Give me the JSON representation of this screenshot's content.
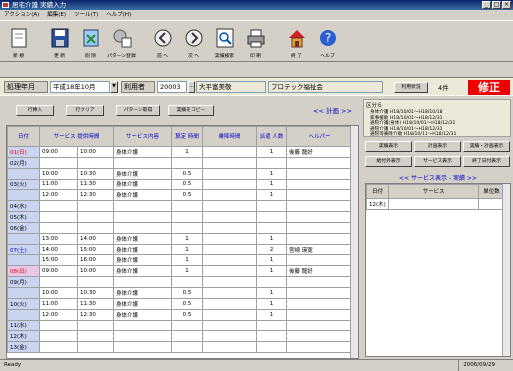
{
  "window": {
    "title": "居宅介護 実績入力"
  },
  "menu": [
    "アクション(A)",
    "編集(E)",
    "ツール(T)",
    "ヘルプ(H)"
  ],
  "toolbar": [
    {
      "label": "新 規",
      "icon": "new-document-icon"
    },
    {
      "label": "更 新",
      "icon": "save-disk-icon"
    },
    {
      "label": "削 除",
      "icon": "delete-icon"
    },
    {
      "label": "パターン登録",
      "icon": "pattern-register-icon"
    },
    {
      "label": "前 へ",
      "icon": "previous-icon"
    },
    {
      "label": "次 へ",
      "icon": "next-icon"
    },
    {
      "label": "実績検索",
      "icon": "search-records-icon"
    },
    {
      "label": "印 刷",
      "icon": "printer-icon"
    },
    {
      "label": "終 了",
      "icon": "home-exit-icon"
    },
    {
      "label": "ヘルプ",
      "icon": "help-icon"
    }
  ],
  "info": {
    "month_label": "処理年月",
    "month_value": "平成18年10月",
    "user_label": "利用者",
    "user_code": "20003",
    "user_name": "大平富美敬",
    "office": "プロテック福祉会",
    "usage_label": "利用状況",
    "count": "4件",
    "mode": "修正"
  },
  "actions": {
    "input": "行挿入",
    "clear": "行クリア",
    "pattern": "パターン取得",
    "copy": "実績をコピー",
    "plan_link": "<< 計画 >>"
  },
  "grid": {
    "headers": [
      "日付",
      "サービス\n提供時間",
      "",
      "サービス内容",
      "算定\n時間",
      "乗降時間",
      "派遣\n人数",
      "ヘルパー"
    ],
    "rows": [
      {
        "date": "01(日)",
        "c": "red",
        "s": "09:00",
        "e": "10:00",
        "svc": "身体介護",
        "t": "1",
        "n": "1",
        "h": "後藤 龍好"
      },
      {
        "date": "02(月)",
        "c": "",
        "s": "",
        "e": "",
        "svc": "",
        "t": "",
        "n": "",
        "h": ""
      },
      {
        "date": "",
        "c": "",
        "s": "10:00",
        "e": "10:30",
        "svc": "身体介護",
        "t": "0.5",
        "n": "1",
        "h": ""
      },
      {
        "date": "03(火)",
        "c": "",
        "s": "11:00",
        "e": "11:30",
        "svc": "身体介護",
        "t": "0.5",
        "n": "1",
        "h": ""
      },
      {
        "date": "",
        "c": "",
        "s": "12:00",
        "e": "12:30",
        "svc": "身体介護",
        "t": "0.5",
        "n": "1",
        "h": ""
      },
      {
        "date": "04(水)",
        "c": "",
        "s": "",
        "e": "",
        "svc": "",
        "t": "",
        "n": "",
        "h": ""
      },
      {
        "date": "05(木)",
        "c": "",
        "s": "",
        "e": "",
        "svc": "",
        "t": "",
        "n": "",
        "h": ""
      },
      {
        "date": "06(金)",
        "c": "",
        "s": "",
        "e": "",
        "svc": "",
        "t": "",
        "n": "",
        "h": ""
      },
      {
        "date": "",
        "c": "",
        "s": "13:00",
        "e": "14:00",
        "svc": "身体介護",
        "t": "1",
        "n": "1",
        "h": ""
      },
      {
        "date": "07(土)",
        "c": "blue",
        "s": "14:00",
        "e": "15:00",
        "svc": "身体介護",
        "t": "1",
        "n": "2",
        "h": "宮崎 瑛寛"
      },
      {
        "date": "",
        "c": "",
        "s": "15:00",
        "e": "16:00",
        "svc": "身体介護",
        "t": "1",
        "n": "1",
        "h": ""
      },
      {
        "date": "08(日)",
        "c": "red pink",
        "s": "09:00",
        "e": "10:00",
        "svc": "身体介護",
        "t": "1",
        "n": "1",
        "h": "後藤 龍好"
      },
      {
        "date": "09(月)",
        "c": "",
        "s": "",
        "e": "",
        "svc": "",
        "t": "",
        "n": "",
        "h": ""
      },
      {
        "date": "",
        "c": "",
        "s": "10:00",
        "e": "10:30",
        "svc": "身体介護",
        "t": "0.5",
        "n": "1",
        "h": ""
      },
      {
        "date": "10(火)",
        "c": "",
        "s": "11:00",
        "e": "11:30",
        "svc": "身体介護",
        "t": "0.5",
        "n": "1",
        "h": ""
      },
      {
        "date": "",
        "c": "",
        "s": "12:00",
        "e": "12:30",
        "svc": "身体介護",
        "t": "0.5",
        "n": "1",
        "h": ""
      },
      {
        "date": "11(水)",
        "c": "",
        "s": "",
        "e": "",
        "svc": "",
        "t": "",
        "n": "",
        "h": ""
      },
      {
        "date": "12(木)",
        "c": "",
        "s": "",
        "e": "",
        "svc": "",
        "t": "",
        "n": "",
        "h": ""
      },
      {
        "date": "13(金)",
        "c": "",
        "s": "",
        "e": "",
        "svc": "",
        "t": "",
        "n": "",
        "h": ""
      }
    ]
  },
  "kubun": {
    "title": "区分６",
    "lines": [
      "身体介護 H18/10/01～H18/10/18",
      "家事援助 H18/10/01～H18/12/31",
      "通院介護(身体) H18/10/01～H18/12/31",
      "通院介護 H18/10/01～H18/12/31",
      "通院等乗降介助 H18/10/11～H18/12/31"
    ]
  },
  "rbuttons": [
    "実績表示",
    "計画表示",
    "実績・計画表示",
    "給付外表示",
    "サービス表示",
    "終了日付表示"
  ],
  "service_link": "<< サービス表示 - 実績 >>",
  "rgrid": {
    "headers": [
      "日付",
      "サービス",
      "単位数"
    ],
    "rows": [
      {
        "date": "12(木)",
        "svc": "",
        "unit": ""
      }
    ]
  },
  "status": {
    "left": "Ready",
    "right": "2006/09/29"
  }
}
